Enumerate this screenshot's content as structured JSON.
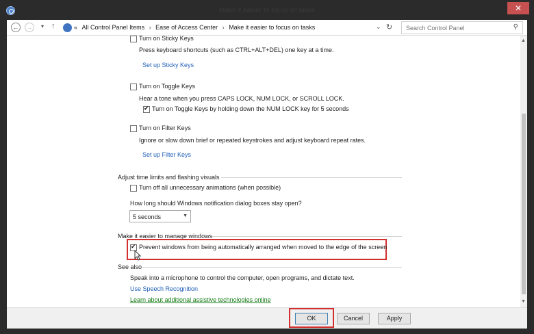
{
  "window": {
    "title": "Make it easier to focus on tasks",
    "close_label": "✕"
  },
  "address": {
    "breadcrumb_prefix": "«",
    "crumbs": [
      "All Control Panel Items",
      "Ease of Access Center",
      "Make it easier to focus on tasks"
    ],
    "separator": "›",
    "search_placeholder": "Search Control Panel"
  },
  "keys": {
    "sticky_label": "Turn on Sticky Keys",
    "sticky_desc": "Press keyboard shortcuts (such as CTRL+ALT+DEL) one key at a time.",
    "sticky_link": "Set up Sticky Keys",
    "toggle_label": "Turn on Toggle Keys",
    "toggle_desc": "Hear a tone when you press CAPS LOCK, NUM LOCK, or SCROLL LOCK.",
    "toggle_sub_label": "Turn on Toggle Keys by holding down the NUM LOCK key for 5 seconds",
    "filter_label": "Turn on Filter Keys",
    "filter_desc": "Ignore or slow down brief or repeated keystrokes and adjust keyboard repeat rates.",
    "filter_link": "Set up Filter Keys"
  },
  "time_limits": {
    "heading": "Adjust time limits and flashing visuals",
    "animations_label": "Turn off all unnecessary animations (when possible)",
    "notification_question": "How long should Windows notification dialog boxes stay open?",
    "notification_value": "5 seconds"
  },
  "windows_mgmt": {
    "heading": "Make it easier to manage windows",
    "prevent_label": "Prevent windows from being automatically arranged when moved to the edge of the screen"
  },
  "see_also": {
    "heading": "See also",
    "speech_desc": "Speak into a microphone to control the computer, open programs, and dictate text.",
    "speech_link": "Use Speech Recognition",
    "assistive_link": "Learn about additional assistive technologies online"
  },
  "footer": {
    "ok": "OK",
    "cancel": "Cancel",
    "apply": "Apply"
  },
  "colors": {
    "link": "#1f5fb8",
    "link_green": "#157a15",
    "highlight": "#d32f2f",
    "close": "#c75050"
  }
}
